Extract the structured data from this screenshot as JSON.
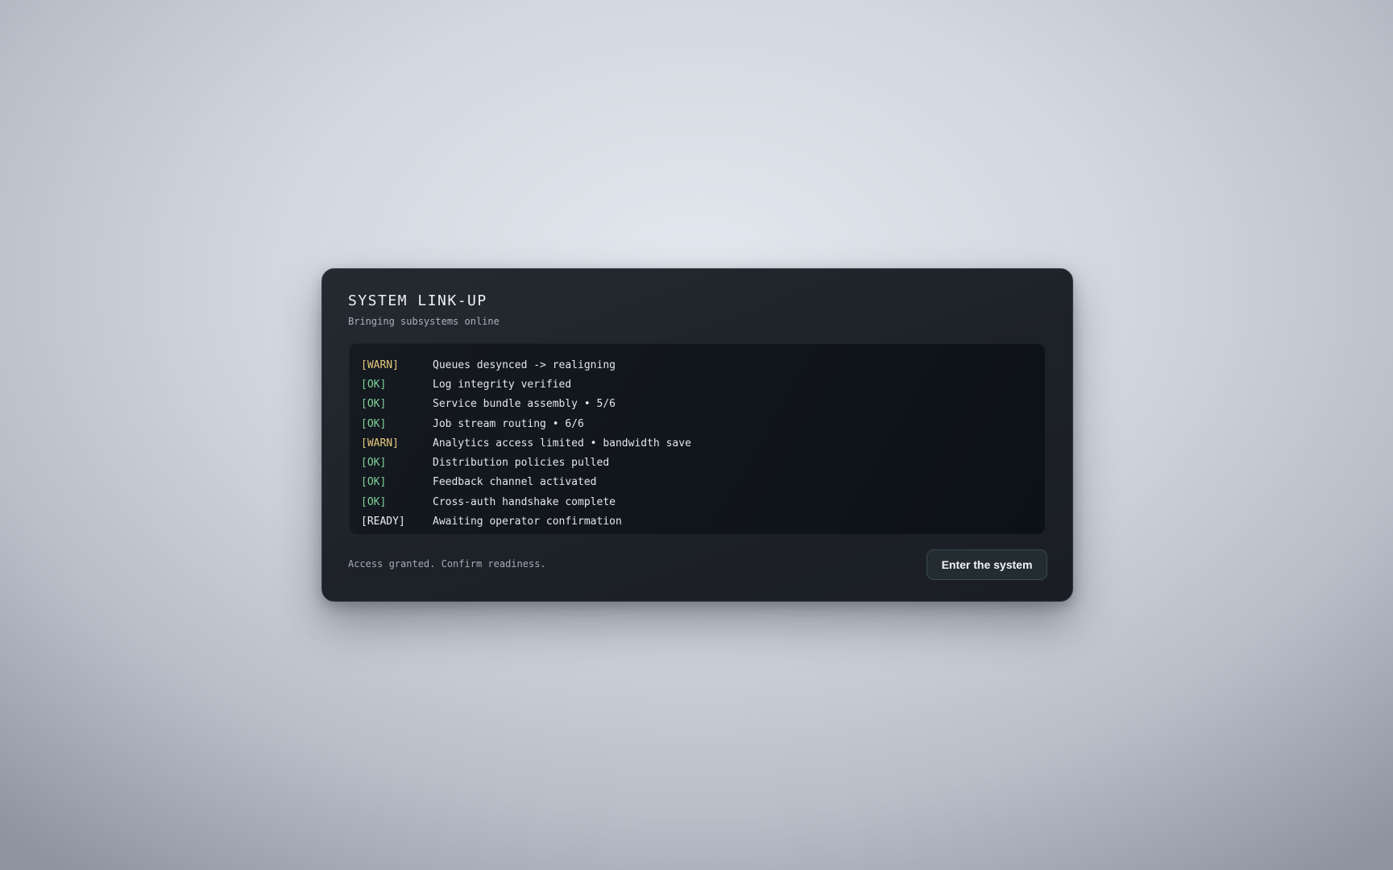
{
  "dialog": {
    "title": "SYSTEM LINK-UP",
    "subtitle": "Bringing subsystems online"
  },
  "log": [
    {
      "tag": "[WARN]",
      "status": "warn",
      "message": "Queues desynced -> realigning"
    },
    {
      "tag": "[OK]",
      "status": "ok",
      "message": "Log integrity verified"
    },
    {
      "tag": "[OK]",
      "status": "ok",
      "message": "Service bundle assembly • 5/6"
    },
    {
      "tag": "[OK]",
      "status": "ok",
      "message": "Job stream routing • 6/6"
    },
    {
      "tag": "[WARN]",
      "status": "warn",
      "message": "Analytics access limited • bandwidth save"
    },
    {
      "tag": "[OK]",
      "status": "ok",
      "message": "Distribution policies pulled"
    },
    {
      "tag": "[OK]",
      "status": "ok",
      "message": "Feedback channel activated"
    },
    {
      "tag": "[OK]",
      "status": "ok",
      "message": "Cross-auth handshake complete"
    },
    {
      "tag": "[READY]",
      "status": "ready",
      "message": "Awaiting operator confirmation"
    }
  ],
  "footer": {
    "status_text": "Access granted. Confirm readiness.",
    "enter_button_label": "Enter the system"
  },
  "colors": {
    "warn": "#e6c97b",
    "ok": "#7fd39a",
    "ready": "#eceff3",
    "panel": "#1d2228",
    "log_background": "#10151b"
  }
}
